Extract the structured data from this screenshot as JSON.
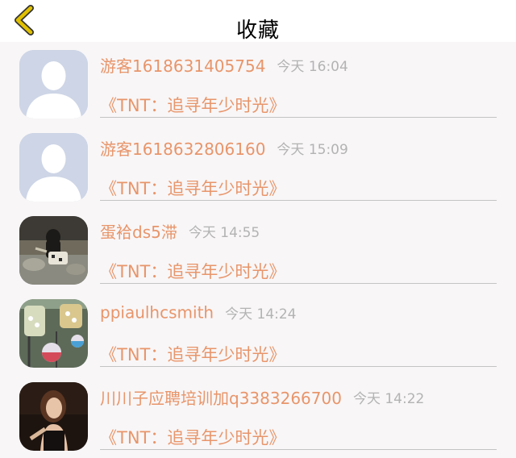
{
  "header": {
    "title": "收藏",
    "back_icon": "chevron-left-icon",
    "accent": "#e0c000"
  },
  "colors": {
    "name": "#e8956a",
    "time": "#b3b3b3"
  },
  "items": [
    {
      "name": "游客1618631405754",
      "time": "今天 16:04",
      "show": "《TNT：追寻年少时光》",
      "avatar": "default-avatar-icon"
    },
    {
      "name": "游客1618632806160",
      "time": "今天 15:09",
      "show": "《TNT：追寻年少时光》",
      "avatar": "default-avatar-icon"
    },
    {
      "name": "蛋袷ds5滞",
      "time": "今天 14:55",
      "show": "《TNT：追寻年少时光》",
      "avatar": "user-photo"
    },
    {
      "name": "ppiaulhcsmith",
      "time": "今天 14:24",
      "show": "《TNT：追寻年少时光》",
      "avatar": "user-photo"
    },
    {
      "name": "川川子应聘培训加q3383266700",
      "time": "今天 14:22",
      "show": "《TNT：追寻年少时光》",
      "avatar": "user-photo"
    }
  ]
}
